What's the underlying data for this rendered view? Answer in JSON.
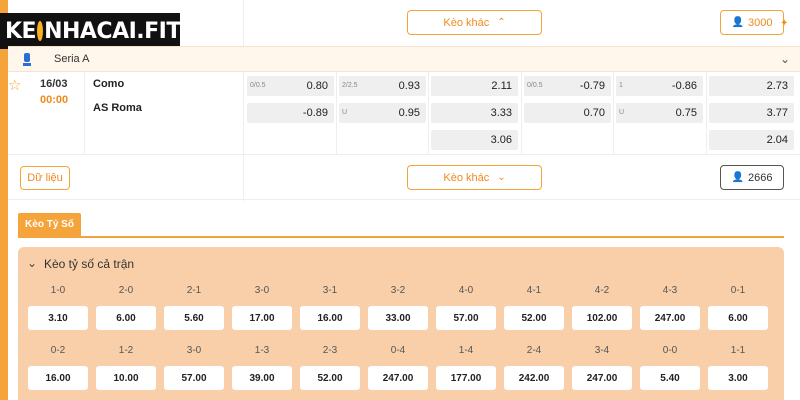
{
  "brand": {
    "logo_k": "KE",
    "logo_rest": "NHACAI.FIT"
  },
  "top_row": {
    "more_label": "Kèo khác",
    "count": "3000"
  },
  "league": {
    "name": "Seria A"
  },
  "match": {
    "date": "16/03",
    "time": "00:00",
    "home": "Como",
    "away": "AS Roma",
    "odds": {
      "c1": {
        "r1": {
          "lbl": "0/0.5",
          "val": "0.80"
        },
        "r2": {
          "lbl": "",
          "val": "-0.89"
        }
      },
      "c2": {
        "r1": {
          "lbl": "2/2.5",
          "val": "0.93"
        },
        "r2": {
          "lbl": "U",
          "val": "0.95"
        }
      },
      "c3": {
        "r1": "2.11",
        "r2": "3.33",
        "r3": "3.06"
      },
      "c4": {
        "r1": {
          "lbl": "0/0.5",
          "val": "-0.79"
        },
        "r2": {
          "lbl": "",
          "val": "0.70"
        }
      },
      "c5": {
        "r1": {
          "lbl": "1",
          "val": "-0.86"
        },
        "r2": {
          "lbl": "U",
          "val": "0.75"
        }
      },
      "c6": {
        "r1": "2.73",
        "r2": "3.77",
        "r3": "2.04"
      }
    }
  },
  "bottom_row": {
    "data_label": "Dữ liệu",
    "more_label": "Kèo khác",
    "count": "2666"
  },
  "score_section": {
    "tab_label": "Kèo Tỷ Số",
    "panel_title": "Kèo tỷ số cả trận",
    "row1": [
      {
        "score": "1-0",
        "odds": "3.10"
      },
      {
        "score": "2-0",
        "odds": "6.00"
      },
      {
        "score": "2-1",
        "odds": "5.60"
      },
      {
        "score": "3-0",
        "odds": "17.00"
      },
      {
        "score": "3-1",
        "odds": "16.00"
      },
      {
        "score": "3-2",
        "odds": "33.00"
      },
      {
        "score": "4-0",
        "odds": "57.00"
      },
      {
        "score": "4-1",
        "odds": "52.00"
      },
      {
        "score": "4-2",
        "odds": "102.00"
      },
      {
        "score": "4-3",
        "odds": "247.00"
      },
      {
        "score": "0-1",
        "odds": "6.00"
      }
    ],
    "row2": [
      {
        "score": "0-2",
        "odds": "16.00"
      },
      {
        "score": "1-2",
        "odds": "10.00"
      },
      {
        "score": "3-0",
        "odds": "57.00"
      },
      {
        "score": "1-3",
        "odds": "39.00"
      },
      {
        "score": "2-3",
        "odds": "52.00"
      },
      {
        "score": "0-4",
        "odds": "247.00"
      },
      {
        "score": "1-4",
        "odds": "177.00"
      },
      {
        "score": "2-4",
        "odds": "242.00"
      },
      {
        "score": "3-4",
        "odds": "247.00"
      },
      {
        "score": "0-0",
        "odds": "5.40"
      },
      {
        "score": "1-1",
        "odds": "3.00"
      }
    ]
  },
  "colors": {
    "accent": "#f4a43a",
    "accent_text": "#f08a1c",
    "panel_bg": "#f8cfa9",
    "cell_bg": "#efefef"
  }
}
